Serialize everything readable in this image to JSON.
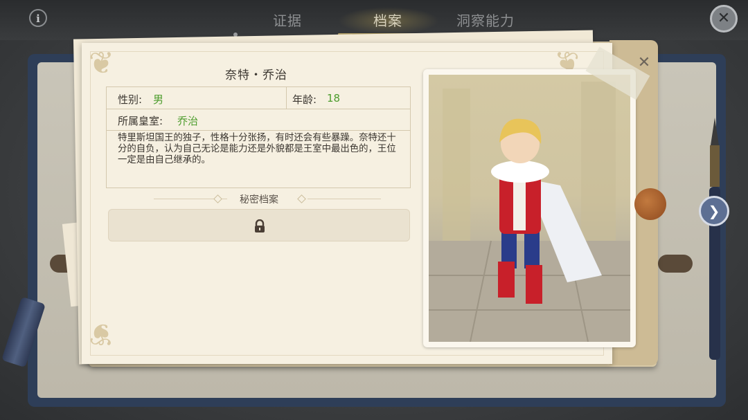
{
  "tabs": [
    {
      "label": "证据",
      "active": false
    },
    {
      "label": "档案",
      "active": true
    },
    {
      "label": "洞察能力",
      "active": false
    }
  ],
  "icons": {
    "info": "i",
    "close_top": "✕",
    "close_card": "✕",
    "next": "❯"
  },
  "profile": {
    "name": "奈特・乔治",
    "gender_label": "性别:",
    "gender_value": "男",
    "age_label": "年龄:",
    "age_value": "18",
    "house_label": "所属皇室:",
    "house_value": "乔治",
    "description": "特里斯坦国王的独子，性格十分张扬，有时还会有些暴躁。奈特还十分的自负，认为自己无论是能力还是外貌都是王室中最出色的，王位一定是由自己继承的。"
  },
  "secret": {
    "title": "秘密档案",
    "locked": true
  },
  "colors": {
    "value_green": "#4c9c2c",
    "active_tab": "#d8d2bd",
    "tab_underline": "#b9a56a"
  }
}
